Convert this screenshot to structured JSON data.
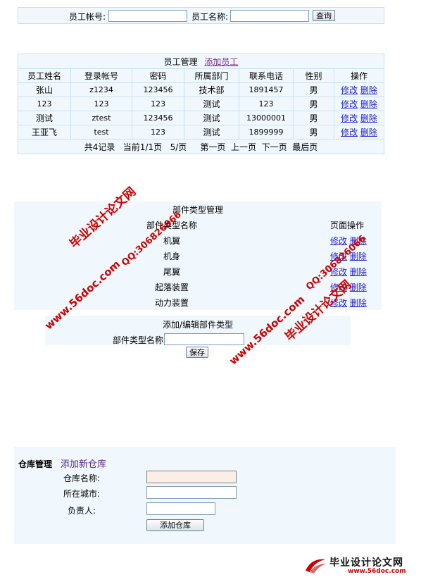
{
  "search": {
    "account_label": "员工帐号:",
    "name_label": "员工名称:",
    "account_value": "",
    "name_value": "",
    "query_button": "查询"
  },
  "employee": {
    "title": "员工管理",
    "add_link": "添加员工",
    "headers": [
      "员工姓名",
      "登录帐号",
      "密码",
      "所属部门",
      "联系电话",
      "性别",
      "操作"
    ],
    "rows": [
      {
        "name": "张山",
        "account": "z1234",
        "password": "123456",
        "dept": "技术部",
        "phone": "1891457",
        "gender": "男"
      },
      {
        "name": "123",
        "account": "123",
        "password": "123",
        "dept": "测试",
        "phone": "123",
        "gender": "男"
      },
      {
        "name": "测试",
        "account": "ztest",
        "password": "123456",
        "dept": "测试",
        "phone": "13000001",
        "gender": "男"
      },
      {
        "name": "王亚飞",
        "account": "test",
        "password": "123",
        "dept": "测试",
        "phone": "1899999",
        "gender": "男"
      }
    ],
    "edit_label": "修改",
    "delete_label": "删除",
    "pager": {
      "total": "共4记录",
      "current": "当前1/1页",
      "per_page": "5/页",
      "first": "第一页",
      "prev": "上一页",
      "next": "下一页",
      "last": "最后页"
    }
  },
  "parttype": {
    "title": "部件类型管理",
    "col_name": "部件类型名称",
    "col_ops": "页面操作",
    "items": [
      "机翼",
      "机身",
      "尾翼",
      "起落装置",
      "动力装置"
    ],
    "edit_label": "修改",
    "delete_label": "删除",
    "form_title": "添加/编辑部件类型",
    "form_label": "部件类型名称",
    "form_value": "",
    "save_button": "保存"
  },
  "warehouse": {
    "title": "仓库管理",
    "add_link": "添加新仓库",
    "name_label": "仓库名称:",
    "city_label": "所在城市:",
    "manager_label": "负责人:",
    "name_value": "",
    "city_value": "",
    "manager_value": "",
    "add_button": "添加仓库"
  },
  "watermark": {
    "site": "www.56doc.com",
    "qq": "QQ:306826066",
    "brand": "毕业设计论文网",
    "footer_brand": "毕业设计论文网",
    "footer_url": "www.56doc.com",
    "color": "#cc0000"
  }
}
